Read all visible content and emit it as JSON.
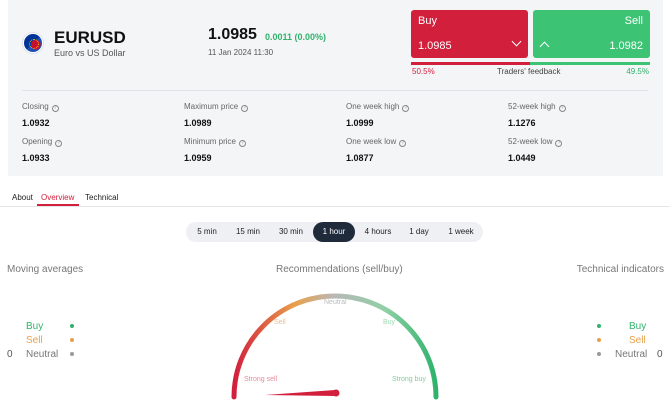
{
  "instrument": {
    "symbol": "EURUSD",
    "name": "Euro vs US Dollar",
    "price": "1.0985",
    "change": "0.0011 (0.00%)",
    "datetime": "11 Jan 2024 11:30",
    "flag_icon": "eu-flag-icon"
  },
  "trade": {
    "buy_label": "Buy",
    "buy_price": "1.0985",
    "sell_label": "Sell",
    "sell_price": "1.0982",
    "feedback_buy_pct": "50.5%",
    "feedback_label": "Traders' feedback",
    "feedback_sell_pct": "49.5%",
    "buy_share": 0.505,
    "colors": {
      "buy": "#d21f3c",
      "sell": "#3cc474"
    }
  },
  "stats": [
    {
      "label": "Closing",
      "value": "1.0932"
    },
    {
      "label": "Maximum price",
      "value": "1.0989"
    },
    {
      "label": "One week high",
      "value": "1.0999"
    },
    {
      "label": "52-week high",
      "value": "1.1276"
    },
    {
      "label": "Opening",
      "value": "1.0933"
    },
    {
      "label": "Minimum price",
      "value": "1.0959"
    },
    {
      "label": "One week low",
      "value": "1.0877"
    },
    {
      "label": "52-week low",
      "value": "1.0449"
    }
  ],
  "tabs": [
    "About",
    "Overview",
    "Technical"
  ],
  "active_tab": "Overview",
  "timeframes": [
    "5 min",
    "15 min",
    "30 min",
    "1 hour",
    "4 hours",
    "1 day",
    "1 week"
  ],
  "active_timeframe": "1 hour",
  "sections": {
    "moving_averages": "Moving averages",
    "recommendations": "Recommendations (sell/buy)",
    "technical_indicators": "Technical indicators"
  },
  "legend": {
    "buy": "Buy",
    "sell": "Sell",
    "neutral": "Neutral",
    "ma_neutral_count": "0",
    "ti_neutral_count": "0"
  },
  "gauge": {
    "labels": {
      "strong_sell": "Strong sell",
      "sell": "Sell",
      "neutral": "Neutral",
      "buy": "Buy",
      "strong_buy": "Strong buy"
    },
    "needle_value": 0.0
  }
}
